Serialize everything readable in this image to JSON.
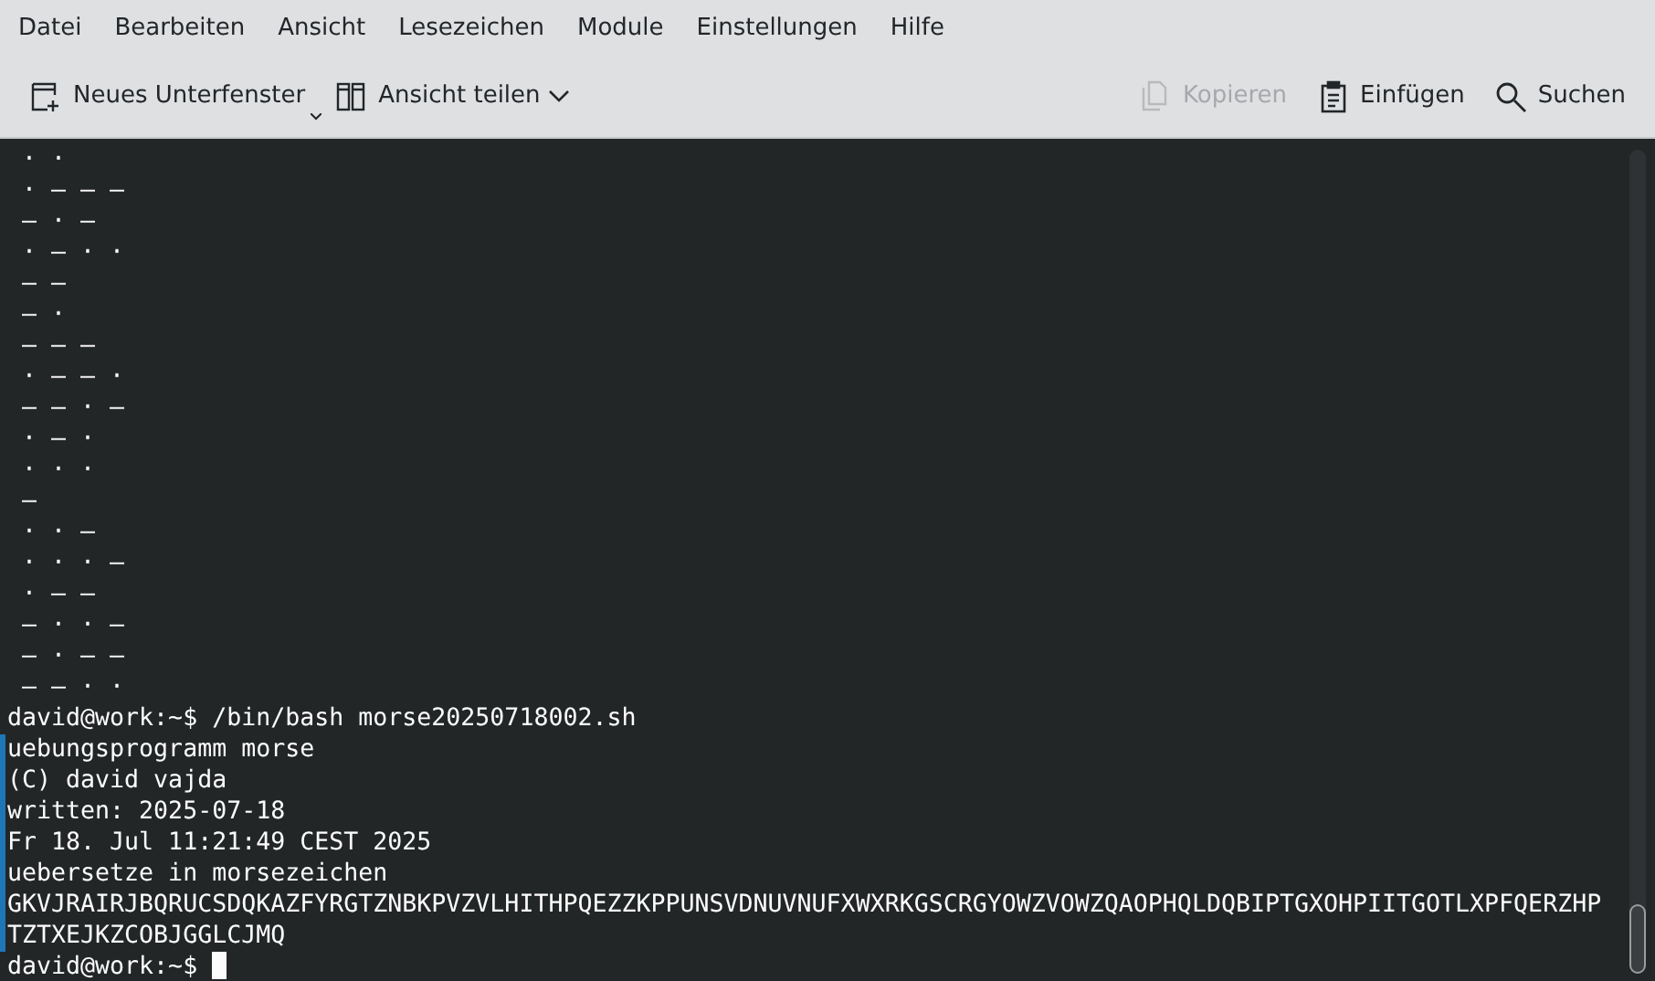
{
  "menu": [
    "Datei",
    "Bearbeiten",
    "Ansicht",
    "Lesezeichen",
    "Module",
    "Einstellungen",
    "Hilfe"
  ],
  "toolbar_left": [
    {
      "kind": "new-tab",
      "label": "Neues Unterfenster",
      "disabled": false
    },
    {
      "kind": "split",
      "label": "Ansicht teilen",
      "disabled": false
    }
  ],
  "toolbar_right": [
    {
      "kind": "copy",
      "label": "Kopieren",
      "disabled": true
    },
    {
      "kind": "paste",
      "label": "Einfügen",
      "disabled": false
    },
    {
      "kind": "search",
      "label": "Suchen",
      "disabled": false
    }
  ],
  "terminal": {
    "lines": [
      {
        "kind": "plain",
        "text": " · ·"
      },
      {
        "kind": "plain",
        "text": " · – – –"
      },
      {
        "kind": "plain",
        "text": " – · –"
      },
      {
        "kind": "plain",
        "text": " · – · ·"
      },
      {
        "kind": "plain",
        "text": " – –"
      },
      {
        "kind": "plain",
        "text": " – ·"
      },
      {
        "kind": "plain",
        "text": " – – –"
      },
      {
        "kind": "plain",
        "text": " · – – ·"
      },
      {
        "kind": "plain",
        "text": " – – · –"
      },
      {
        "kind": "plain",
        "text": " · – ·"
      },
      {
        "kind": "plain",
        "text": " · · ·"
      },
      {
        "kind": "plain",
        "text": " –"
      },
      {
        "kind": "plain",
        "text": " · · –"
      },
      {
        "kind": "plain",
        "text": " · · · –"
      },
      {
        "kind": "plain",
        "text": " · – –"
      },
      {
        "kind": "plain",
        "text": " – · · –"
      },
      {
        "kind": "plain",
        "text": " – · – –"
      },
      {
        "kind": "plain",
        "text": " – – · ·"
      },
      {
        "kind": "prompt",
        "text": "david@work:~$ /bin/bash morse20250718002.sh"
      },
      {
        "kind": "output",
        "text": "uebungsprogramm morse"
      },
      {
        "kind": "output",
        "text": "(C) david vajda"
      },
      {
        "kind": "output",
        "text": "written: 2025-07-18"
      },
      {
        "kind": "output",
        "text": "Fr 18. Jul 11:21:49 CEST 2025"
      },
      {
        "kind": "output",
        "text": "uebersetze in morsezeichen"
      },
      {
        "kind": "output",
        "text": "GKVJRAIRJBQRUCSDQKAZFYRGTZNBKPVZVLHITHPQEZZKPPUNSVDNUVNUFXWXRKGSCRGYOWZVOWZQAOPHQLDQBIPTGXOHPIITGOTLXPFQERZHP"
      },
      {
        "kind": "output",
        "text": "TZTXEJKZCOBJGGLCJMQ"
      },
      {
        "kind": "cursor",
        "text": "david@work:~$ "
      }
    ]
  }
}
